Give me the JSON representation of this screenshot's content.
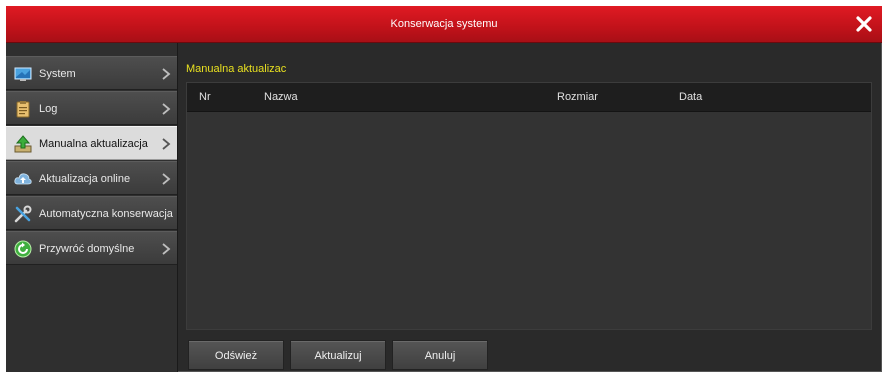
{
  "window": {
    "title": "Konserwacja systemu"
  },
  "sidebar": {
    "items": [
      {
        "label": "System",
        "icon": "system-monitor-icon",
        "active": false
      },
      {
        "label": "Log",
        "icon": "log-clipboard-icon",
        "active": false
      },
      {
        "label": "Manualna aktualizacja",
        "icon": "upload-arrow-icon",
        "active": true
      },
      {
        "label": "Aktualizacja online",
        "icon": "cloud-icon",
        "active": false
      },
      {
        "label": "Automatyczna konserwacja",
        "icon": "tools-icon",
        "active": false
      },
      {
        "label": "Przywróć domyślne",
        "icon": "restore-icon",
        "active": false
      }
    ]
  },
  "main": {
    "heading": "Manualna aktualizac",
    "table": {
      "columns": [
        "Nr",
        "Nazwa",
        "Rozmiar",
        "Data"
      ],
      "rows": []
    }
  },
  "buttons": {
    "refresh": "Odśwież",
    "update": "Aktualizuj",
    "cancel": "Anuluj"
  },
  "colors": {
    "titlebar": "#c1121a",
    "heading": "#e8e020",
    "background": "#2a2a2a"
  }
}
